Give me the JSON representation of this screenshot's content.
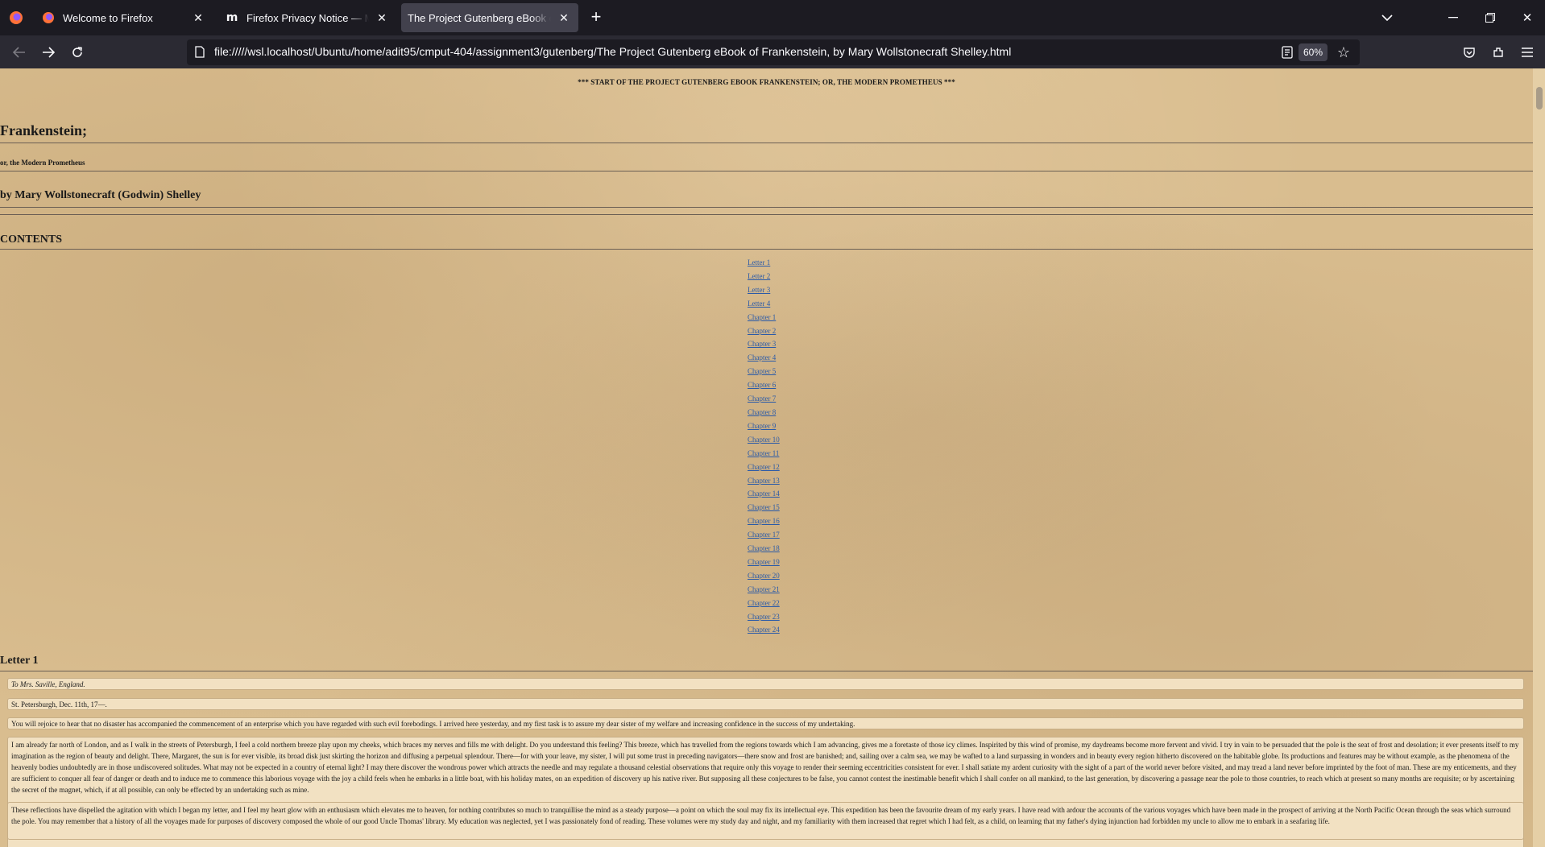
{
  "browser": {
    "tabs": [
      {
        "title": "Welcome to Firefox",
        "favicon": "firefox-icon",
        "active": false
      },
      {
        "title": "Firefox Privacy Notice — Mozilla",
        "favicon": "mozilla-m-icon",
        "active": false
      },
      {
        "title": "The Project Gutenberg eBook of Frankenstein",
        "favicon": "none",
        "active": true
      }
    ],
    "url": "file://///wsl.localhost/Ubuntu/home/adit95/cmput-404/assignment3/gutenberg/The Project Gutenberg eBook of Frankenstein, by Mary Wollstonecraft Shelley.html",
    "zoom": "60%",
    "colors": {
      "tabstrip": "#1c1b22",
      "navbar": "#2b2a33",
      "active_tab": "#42414d"
    }
  },
  "page": {
    "start_line": "*** START OF THE PROJECT GUTENBERG EBOOK FRANKENSTEIN; OR, THE MODERN PROMETHEUS ***",
    "title": "Frankenstein;",
    "subtitle": "or, the Modern Prometheus",
    "author": "by Mary Wollstonecraft (Godwin) Shelley",
    "contents_heading": "CONTENTS",
    "toc": [
      "Letter 1",
      "Letter 2",
      "Letter 3",
      "Letter 4",
      "Chapter 1",
      "Chapter 2",
      "Chapter 3",
      "Chapter 4",
      "Chapter 5",
      "Chapter 6",
      "Chapter 7",
      "Chapter 8",
      "Chapter 9",
      "Chapter 10",
      "Chapter 11",
      "Chapter 12",
      "Chapter 13",
      "Chapter 14",
      "Chapter 15",
      "Chapter 16",
      "Chapter 17",
      "Chapter 18",
      "Chapter 19",
      "Chapter 20",
      "Chapter 21",
      "Chapter 22",
      "Chapter 23",
      "Chapter 24"
    ],
    "letter1_heading": "Letter 1",
    "paragraphs": [
      "To Mrs. Saville, England.",
      "St. Petersburgh, Dec. 11th, 17—.",
      "You will rejoice to hear that no disaster has accompanied the commencement of an enterprise which you have regarded with such evil forebodings. I arrived here yesterday, and my first task is to assure my dear sister of my welfare and increasing confidence in the success of my undertaking.",
      "I am already far north of London, and as I walk in the streets of Petersburgh, I feel a cold northern breeze play upon my cheeks, which braces my nerves and fills me with delight. Do you understand this feeling? This breeze, which has travelled from the regions towards which I am advancing, gives me a foretaste of those icy climes. Inspirited by this wind of promise, my daydreams become more fervent and vivid. I try in vain to be persuaded that the pole is the seat of frost and desolation; it ever presents itself to my imagination as the region of beauty and delight. There, Margaret, the sun is for ever visible, its broad disk just skirting the horizon and diffusing a perpetual splendour. There—for with your leave, my sister, I will put some trust in preceding navigators—there snow and frost are banished; and, sailing over a calm sea, we may be wafted to a land surpassing in wonders and in beauty every region hitherto discovered on the habitable globe. Its productions and features may be without example, as the phenomena of the heavenly bodies undoubtedly are in those undiscovered solitudes. What may not be expected in a country of eternal light? I may there discover the wondrous power which attracts the needle and may regulate a thousand celestial observations that require only this voyage to render their seeming eccentricities consistent for ever. I shall satiate my ardent curiosity with the sight of a part of the world never before visited, and may tread a land never before imprinted by the foot of man. These are my enticements, and they are sufficient to conquer all fear of danger or death and to induce me to commence this laborious voyage with the joy a child feels when he embarks in a little boat, with his holiday mates, on an expedition of discovery up his native river. But supposing all these conjectures to be false, you cannot contest the inestimable benefit which I shall confer on all mankind, to the last generation, by discovering a passage near the pole to those countries, to reach which at present so many months are requisite; or by ascertaining the secret of the magnet, which, if at all possible, can only be effected by an undertaking such as mine.",
      "These reflections have dispelled the agitation with which I began my letter, and I feel my heart glow with an enthusiasm which elevates me to heaven, for nothing contributes so much to tranquillise the mind as a steady purpose—a point on which the soul may fix its intellectual eye. This expedition has been the favourite dream of my early years. I have read with ardour the accounts of the various voyages which have been made in the prospect of arriving at the North Pacific Ocean through the seas which surround the pole. You may remember that a history of all the voyages made for purposes of discovery composed the whole of our good Uncle Thomas' library. My education was neglected, yet I was passionately fond of reading. These volumes were my study day and night, and my familiarity with them increased that regret which I had felt, as a child, on learning that my father's dying injunction had forbidden my uncle to allow me to embark in a seafaring life."
    ]
  }
}
